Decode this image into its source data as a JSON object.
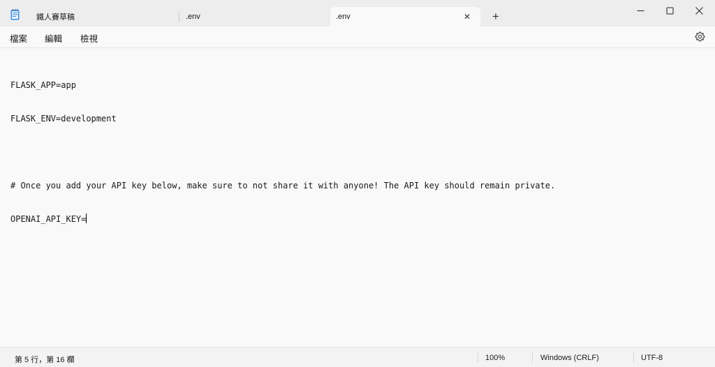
{
  "tabs": [
    {
      "label": "鐵人賽草稿",
      "active": false
    },
    {
      "label": ".env",
      "active": false
    },
    {
      "label": ".env",
      "active": true
    }
  ],
  "tab_close_symbol": "✕",
  "new_tab_symbol": "+",
  "menu": {
    "file": "檔案",
    "edit": "編輯",
    "view": "檢視"
  },
  "editor": {
    "lines": [
      "FLASK_APP=app",
      "FLASK_ENV=development",
      "",
      "# Once you add your API key below, make sure to not share it with anyone! The API key should remain private.",
      "OPENAI_API_KEY="
    ]
  },
  "status": {
    "position": "第 5 行，第 16 欄",
    "zoom": "100%",
    "line_ending": "Windows (CRLF)",
    "encoding": "UTF-8"
  },
  "icons": {
    "app": "notepad-icon",
    "minimize": "minimize-icon",
    "maximize": "maximize-icon",
    "close": "close-icon",
    "settings": "gear-icon"
  },
  "colors": {
    "tabstrip": "#ededed",
    "editor_bg": "#f9f9f9",
    "statusbar": "#f3f3f3",
    "accent": "#3a8ee6"
  }
}
